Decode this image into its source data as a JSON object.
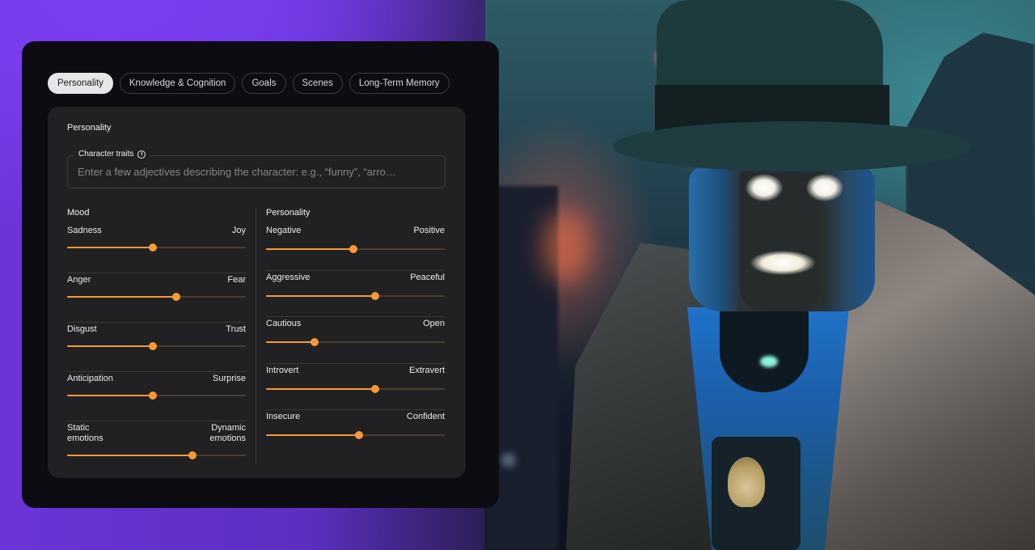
{
  "tabs": [
    {
      "label": "Personality",
      "active": true
    },
    {
      "label": "Knowledge & Cognition",
      "active": false
    },
    {
      "label": "Goals",
      "active": false
    },
    {
      "label": "Scenes",
      "active": false
    },
    {
      "label": "Long-Term Memory",
      "active": false
    }
  ],
  "card": {
    "title": "Personality",
    "character_traits": {
      "label": "Character traits",
      "info_icon": "info-icon",
      "value": "",
      "placeholder": "Enter a few adjectives describing the character: e.g., “funny”, “arro…"
    }
  },
  "mood": {
    "title": "Mood",
    "sliders": [
      {
        "left": "Sadness",
        "right": "Joy",
        "value": 0.48
      },
      {
        "left": "Anger",
        "right": "Fear",
        "value": 0.61
      },
      {
        "left": "Disgust",
        "right": "Trust",
        "value": 0.48
      },
      {
        "left": "Anticipation",
        "right": "Surprise",
        "value": 0.48
      },
      {
        "left": "Static emotions",
        "right": "Dynamic emotions",
        "value": 0.7
      }
    ]
  },
  "personality": {
    "title": "Personality",
    "sliders": [
      {
        "left": "Negative",
        "right": "Positive",
        "value": 0.49
      },
      {
        "left": "Aggressive",
        "right": "Peaceful",
        "value": 0.61
      },
      {
        "left": "Cautious",
        "right": "Open",
        "value": 0.27
      },
      {
        "left": "Introvert",
        "right": "Extravert",
        "value": 0.61
      },
      {
        "left": "Insecure",
        "right": "Confident",
        "value": 0.52
      }
    ]
  },
  "colors": {
    "accent": "#f79a35",
    "track": "#4b3f30",
    "panel": "#0d0c12",
    "card": "#212123",
    "backdrop_purple": "#7a3ff0"
  },
  "scene": {
    "description": "Robot detective character in fedora and trench coat with badge, neon city background"
  }
}
